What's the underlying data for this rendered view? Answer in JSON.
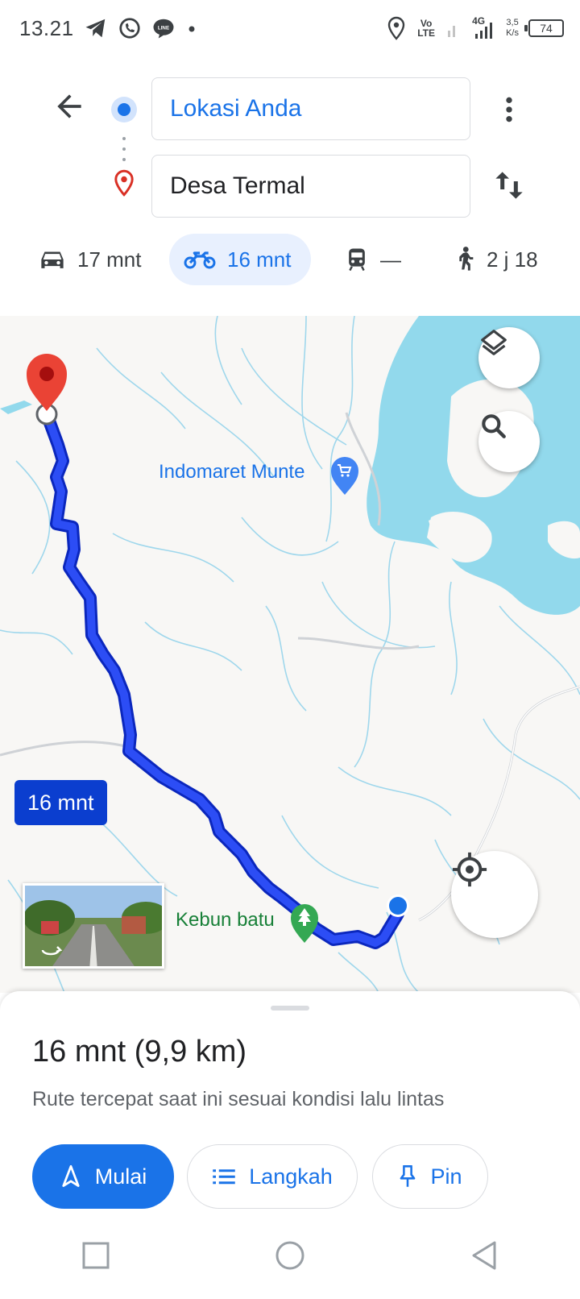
{
  "status_bar": {
    "time": "13.21",
    "volte": "Vo LTE",
    "network": "4G",
    "speed_value": "3,5",
    "speed_unit": "K/s",
    "battery": "74"
  },
  "directions": {
    "origin": "Lokasi Anda",
    "destination": "Desa Termal"
  },
  "modes": [
    {
      "name": "car",
      "label": "17 mnt"
    },
    {
      "name": "motorcycle",
      "label": "16 mnt",
      "selected": true
    },
    {
      "name": "transit",
      "label": "—"
    },
    {
      "name": "walk",
      "label": "2 j 18"
    }
  ],
  "map": {
    "poi_store": "Indomaret Munte",
    "poi_park": "Kebun batu",
    "route_eta": "16 mnt"
  },
  "sheet": {
    "summary": "16 mnt (9,9 km)",
    "subtitle": "Rute tercepat saat ini sesuai kondisi lalu lintas",
    "start_label": "Mulai",
    "steps_label": "Langkah",
    "pin_label": "Pin"
  },
  "colors": {
    "accent": "#1a73e8",
    "route": "#1a3ff0",
    "water": "#92d9ec",
    "pin_red": "#ea4335",
    "park_green": "#34a853"
  }
}
